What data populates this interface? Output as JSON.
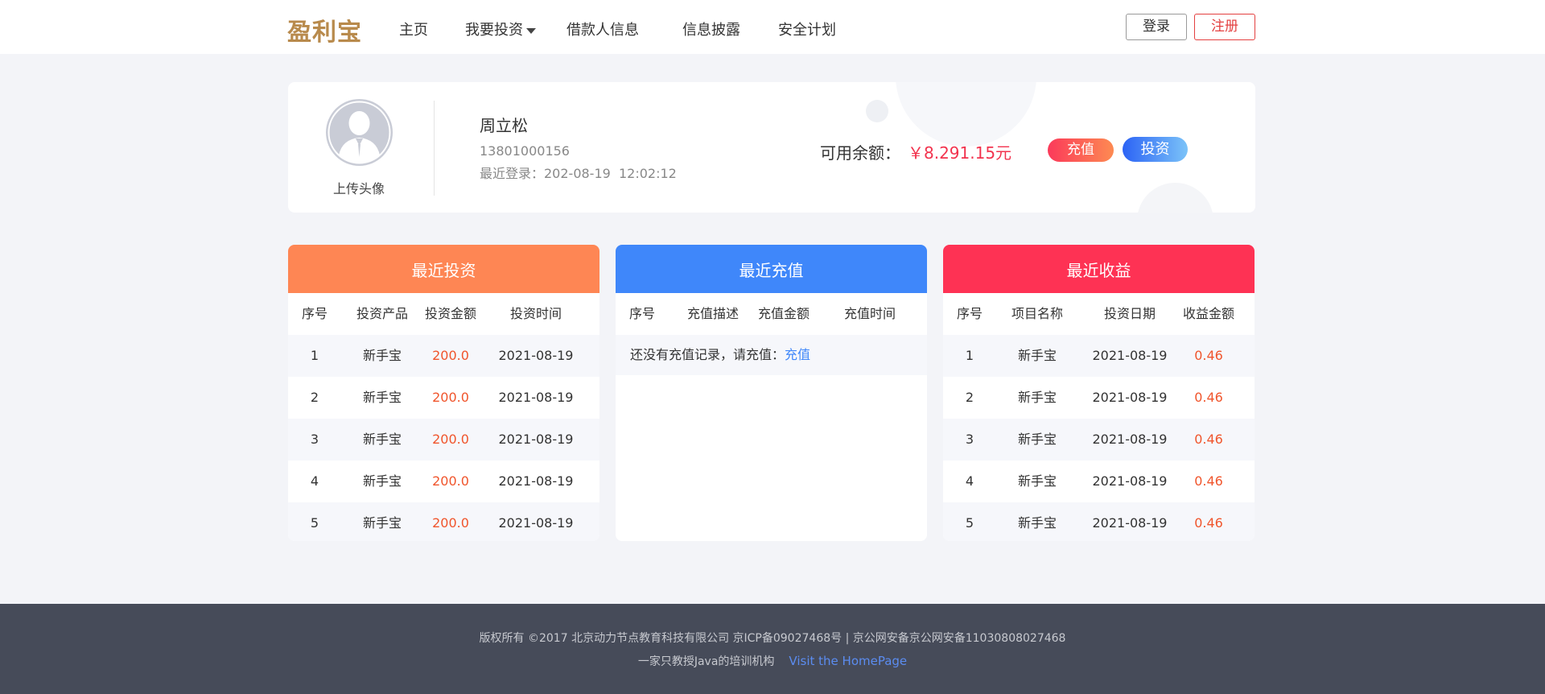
{
  "header": {
    "logo": "盈利宝",
    "nav": [
      "主页",
      "我要投资",
      "借款人信息",
      "信息披露",
      "安全计划"
    ],
    "login": "登录",
    "register": "注册"
  },
  "user": {
    "upload_label": "上传头像",
    "name": "周立松",
    "phone": "13801000156",
    "last_login": "最近登录：202-08-19  12:02:12",
    "balance_label": "可用余额：",
    "balance_value": "￥8.291.15元",
    "recharge_btn": "充值",
    "invest_btn": "投资"
  },
  "invest_panel": {
    "title": "最近投资",
    "columns": [
      "序号",
      "投资产品",
      "投资金额",
      "投资时间"
    ],
    "rows": [
      [
        "1",
        "新手宝",
        "200.0",
        "2021-08-19"
      ],
      [
        "2",
        "新手宝",
        "200.0",
        "2021-08-19"
      ],
      [
        "3",
        "新手宝",
        "200.0",
        "2021-08-19"
      ],
      [
        "4",
        "新手宝",
        "200.0",
        "2021-08-19"
      ],
      [
        "5",
        "新手宝",
        "200.0",
        "2021-08-19"
      ]
    ]
  },
  "recharge_panel": {
    "title": "最近充值",
    "columns": [
      "序号",
      "充值描述",
      "充值金额",
      "充值时间"
    ],
    "empty_text": "还没有充值记录，请充值：",
    "empty_link": "充值"
  },
  "income_panel": {
    "title": "最近收益",
    "columns": [
      "序号",
      "项目名称",
      "投资日期",
      "收益金额"
    ],
    "rows": [
      [
        "1",
        "新手宝",
        "2021-08-19",
        "0.46"
      ],
      [
        "2",
        "新手宝",
        "2021-08-19",
        "0.46"
      ],
      [
        "3",
        "新手宝",
        "2021-08-19",
        "0.46"
      ],
      [
        "4",
        "新手宝",
        "2021-08-19",
        "0.46"
      ],
      [
        "5",
        "新手宝",
        "2021-08-19",
        "0.46"
      ]
    ]
  },
  "footer": {
    "line1": "版权所有 ©2017 北京动力节点教育科技有限公司 京ICP备09027468号 | 京公网安备京公网安备11030808027468",
    "line2": "一家只教授Java的培训机构",
    "link": "Visit the HomePage"
  },
  "colors": {
    "invest_header": "#fe8654",
    "recharge_header": "#3f87fa",
    "income_header": "#fe3254",
    "amount_red": "#f0552c",
    "balance_red": "#f2334e"
  }
}
